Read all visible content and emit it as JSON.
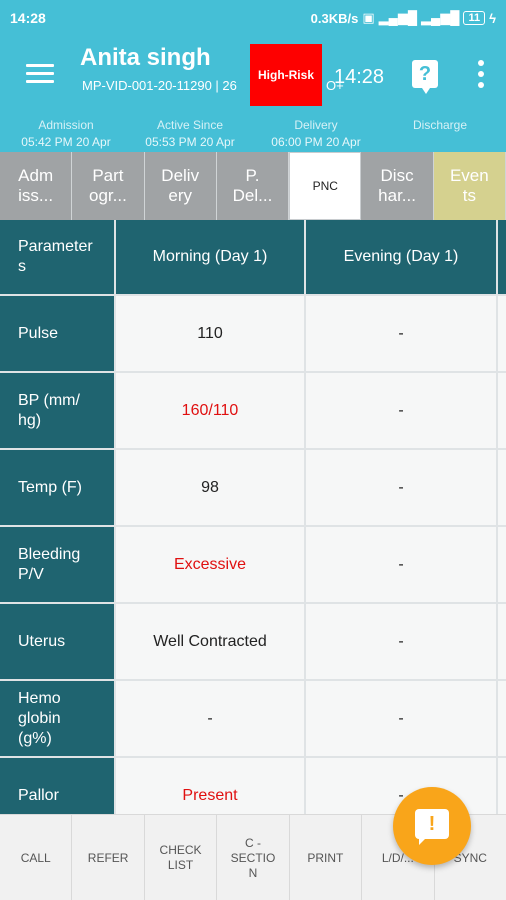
{
  "status_bar": {
    "time": "14:28",
    "network_speed": "0.3KB/s",
    "icons": [
      "data-saver-icon",
      "signal-4g-icon",
      "signal-icon",
      "battery-icon",
      "charging-icon"
    ],
    "battery_label": "11"
  },
  "header": {
    "patient_name": "Anita singh",
    "patient_id": "MP-VID-001-20-11290 | 26",
    "patient_id_extra": "O+",
    "risk_badge": "High-Risk",
    "time": "14:28",
    "help_icon_label": "?",
    "colors": {
      "bar": "#45bfd6",
      "risk": "#fe0000"
    }
  },
  "dates": [
    {
      "label": "Admission",
      "value": "05:42 PM 20 Apr"
    },
    {
      "label": "Active Since",
      "value": "05:53 PM 20 Apr"
    },
    {
      "label": "Delivery",
      "value": "06:00 PM 20 Apr"
    },
    {
      "label": "Discharge",
      "value": ""
    }
  ],
  "tabs": [
    {
      "label": "Adm\niss..."
    },
    {
      "label": "Part\nogr..."
    },
    {
      "label": "Deliv\nery"
    },
    {
      "label": "P.\nDel..."
    },
    {
      "label": "PNC"
    },
    {
      "label": "Disc\nhar..."
    },
    {
      "label": "Even\nts"
    }
  ],
  "table": {
    "headers": [
      "Parameter\ns",
      "Morning (Day 1)",
      "Evening (Day 1)"
    ],
    "rows": [
      {
        "param": "Pulse",
        "morning": "110",
        "evening": "-"
      },
      {
        "param": "BP (mm/\nhg)",
        "morning": "160/110",
        "evening": "-"
      },
      {
        "param": "Temp (F)",
        "morning": "98",
        "evening": "-"
      },
      {
        "param": "Bleeding\nP/V",
        "morning": "Excessive",
        "evening": "-"
      },
      {
        "param": "Uterus",
        "morning": "Well Contracted",
        "evening": "-"
      },
      {
        "param": "Hemo\nglobin\n(g%)",
        "morning": "-",
        "evening": "-"
      },
      {
        "param": "Pallor",
        "morning": "Present",
        "evening": "-"
      }
    ]
  },
  "bottom_bar": [
    "CALL",
    "REFER",
    "CHECK\nLIST",
    "C -\nSECTIO\nN",
    "PRINT",
    "L/D/...",
    "SYNC"
  ],
  "fab": {
    "icon": "alert-message-icon",
    "label": "!",
    "color": "#f9a51a"
  }
}
